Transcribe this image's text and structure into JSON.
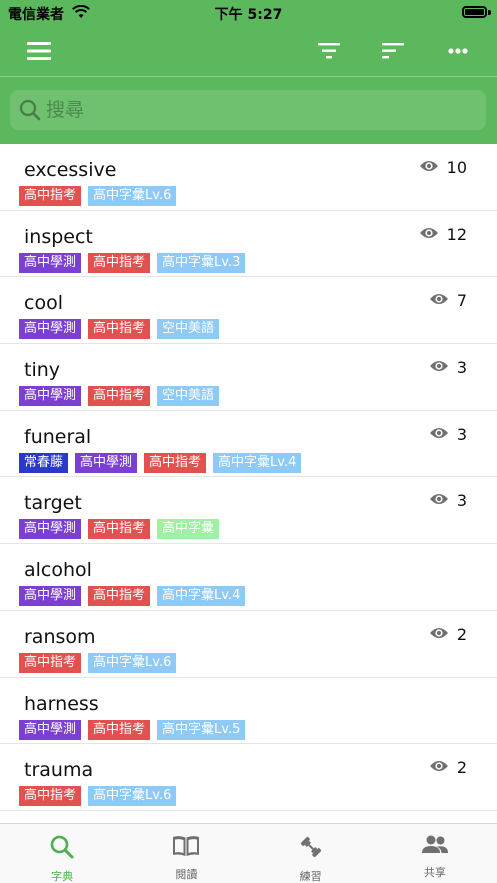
{
  "status_bar": {
    "carrier": "電信業者",
    "time": "下午 5:27"
  },
  "search": {
    "placeholder": "搜尋"
  },
  "words": [
    {
      "word": "excessive",
      "views": "10",
      "tags": [
        {
          "label": "高中指考",
          "kind": "zhikao"
        },
        {
          "label": "高中字彙Lv.6",
          "kind": "zihui"
        }
      ]
    },
    {
      "word": "inspect",
      "views": "12",
      "tags": [
        {
          "label": "高中學測",
          "kind": "xuece"
        },
        {
          "label": "高中指考",
          "kind": "zhikao"
        },
        {
          "label": "高中字彙Lv.3",
          "kind": "zihui"
        }
      ]
    },
    {
      "word": "cool",
      "views": "7",
      "tags": [
        {
          "label": "高中學測",
          "kind": "xuece"
        },
        {
          "label": "高中指考",
          "kind": "zhikao"
        },
        {
          "label": "空中美語",
          "kind": "kongzhong"
        }
      ]
    },
    {
      "word": "tiny",
      "views": "3",
      "tags": [
        {
          "label": "高中學測",
          "kind": "xuece"
        },
        {
          "label": "高中指考",
          "kind": "zhikao"
        },
        {
          "label": "空中美語",
          "kind": "kongzhong"
        }
      ]
    },
    {
      "word": "funeral",
      "views": "3",
      "tags": [
        {
          "label": "常春藤",
          "kind": "changchun"
        },
        {
          "label": "高中學測",
          "kind": "xuece"
        },
        {
          "label": "高中指考",
          "kind": "zhikao"
        },
        {
          "label": "高中字彙Lv.4",
          "kind": "zihui"
        }
      ]
    },
    {
      "word": "target",
      "views": "3",
      "tags": [
        {
          "label": "高中學測",
          "kind": "xuece"
        },
        {
          "label": "高中指考",
          "kind": "zhikao"
        },
        {
          "label": "高中字彙",
          "kind": "zihui-green"
        }
      ]
    },
    {
      "word": "alcohol",
      "views": "",
      "tags": [
        {
          "label": "高中學測",
          "kind": "xuece"
        },
        {
          "label": "高中指考",
          "kind": "zhikao"
        },
        {
          "label": "高中字彙Lv.4",
          "kind": "zihui"
        }
      ]
    },
    {
      "word": "ransom",
      "views": "2",
      "tags": [
        {
          "label": "高中指考",
          "kind": "zhikao"
        },
        {
          "label": "高中字彙Lv.6",
          "kind": "zihui"
        }
      ]
    },
    {
      "word": "harness",
      "views": "",
      "tags": [
        {
          "label": "高中學測",
          "kind": "xuece"
        },
        {
          "label": "高中指考",
          "kind": "zhikao"
        },
        {
          "label": "高中字彙Lv.5",
          "kind": "zihui"
        }
      ]
    },
    {
      "word": "trauma",
      "views": "2",
      "tags": [
        {
          "label": "高中指考",
          "kind": "zhikao"
        },
        {
          "label": "高中字彙Lv.6",
          "kind": "zihui"
        }
      ]
    }
  ],
  "tabs": [
    {
      "label": "字典",
      "icon": "search-icon",
      "active": true
    },
    {
      "label": "閱讀",
      "icon": "book-icon",
      "active": false
    },
    {
      "label": "練習",
      "icon": "dumbbell-icon",
      "active": false
    },
    {
      "label": "共享",
      "icon": "people-icon",
      "active": false
    }
  ],
  "colors": {
    "primary": "#5cb85c",
    "active_tab": "#4caf50"
  }
}
